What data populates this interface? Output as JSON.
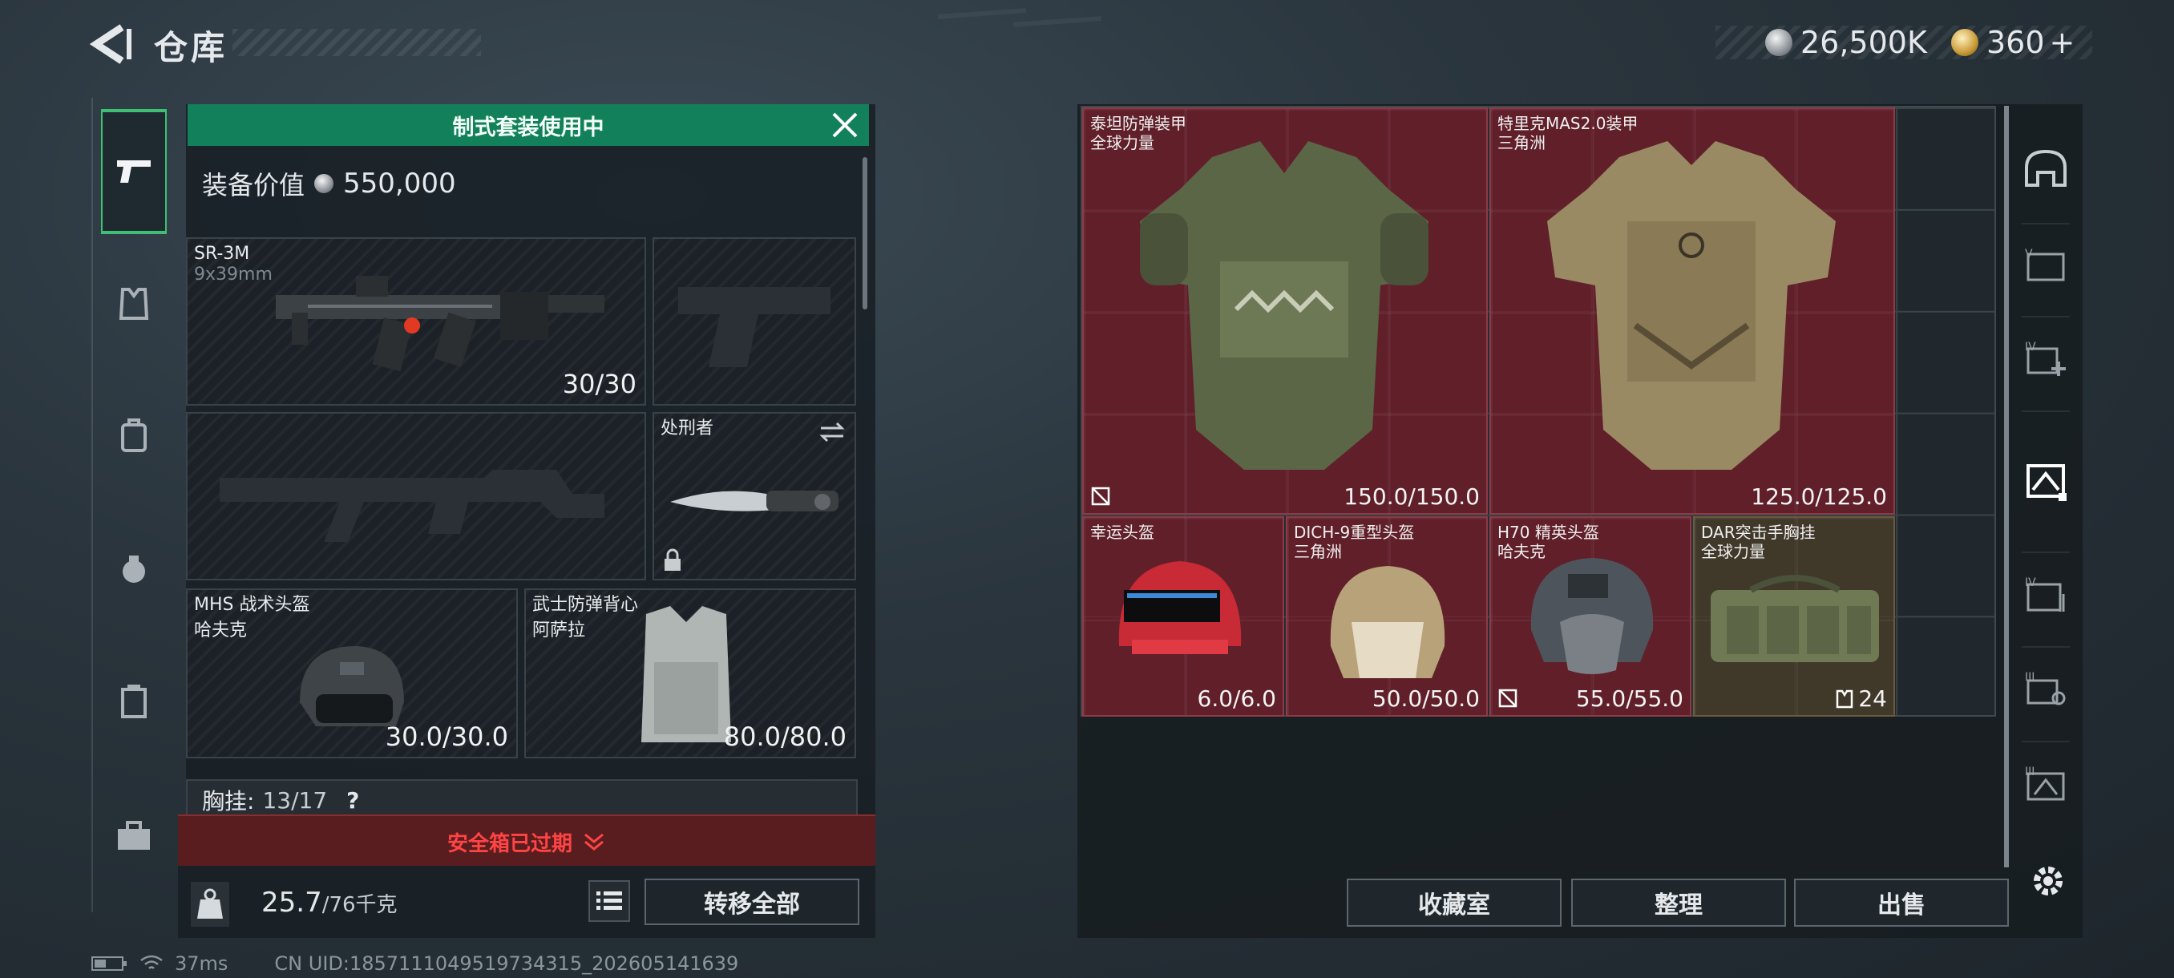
{
  "header": {
    "title": "仓库",
    "currency_silver": "26,500K",
    "currency_gold": "360",
    "gold_plus": "+"
  },
  "loadout": {
    "banner": "制式套装使用中",
    "equip_value_label": "装备价值",
    "equip_value": "550,000",
    "primary_weapon": {
      "name": "SR-3M",
      "ammo_type": "9x39mm",
      "ammo": "30/30"
    },
    "melee": {
      "name": "处刑者"
    },
    "helmet": {
      "name": "MHS 战术头盔",
      "faction": "哈夫克",
      "durability": "30.0/30.0"
    },
    "armor": {
      "name": "武士防弹背心",
      "faction": "阿萨拉",
      "durability": "80.0/80.0"
    },
    "chest_rig": {
      "label": "胸挂:",
      "count": "13/17",
      "help": "?"
    },
    "safebox": "安全箱已过期",
    "weight_current": "25.7",
    "weight_max": "/76千克",
    "transfer_all": "转移全部"
  },
  "status": {
    "ping": "37ms",
    "uid": "CN UID:1857111049519734315_202605141639"
  },
  "storage": {
    "items": [
      {
        "name": "泰坦防弹装甲",
        "faction": "全球力量",
        "durability": "150.0/150.0"
      },
      {
        "name": "特里克MAS2.0装甲",
        "faction": "三角洲",
        "durability": "125.0/125.0"
      },
      {
        "name": "幸运头盔",
        "faction": "",
        "durability": "6.0/6.0"
      },
      {
        "name": "DICH-9重型头盔",
        "faction": "三角洲",
        "durability": "50.0/50.0"
      },
      {
        "name": "H70 精英头盔",
        "faction": "哈夫克",
        "durability": "55.0/55.0"
      },
      {
        "name": "DAR突击手胸挂",
        "faction": "全球力量",
        "capacity": "24"
      }
    ],
    "buttons": {
      "collection": "收藏室",
      "organize": "整理",
      "sell": "出售"
    }
  },
  "colors": {
    "banner_green": "#12805a",
    "item_red": "#781c28",
    "safebox_red": "#ff4444",
    "active_green": "#3fbf73"
  }
}
